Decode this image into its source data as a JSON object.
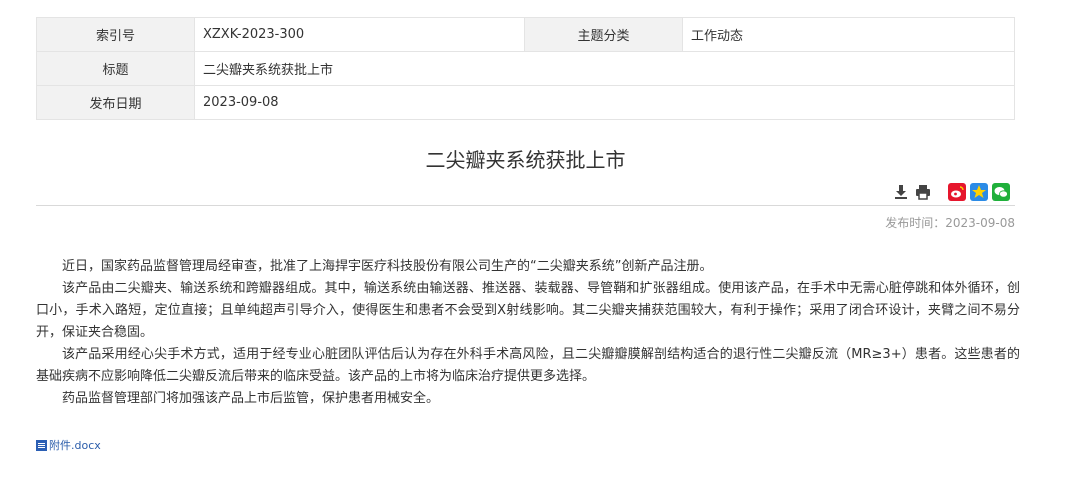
{
  "meta": {
    "index_label": "索引号",
    "index_value": "XZXK-2023-300",
    "category_label": "主题分类",
    "category_value": "工作动态",
    "title_label": "标题",
    "title_value": "二尖瓣夹系统获批上市",
    "date_label": "发布日期",
    "date_value": "2023-09-08"
  },
  "article": {
    "title": "二尖瓣夹系统获批上市",
    "pub_time_label": "发布时间：",
    "pub_time_value": "2023-09-08",
    "paragraphs": [
      "近日，国家药品监督管理局经审查，批准了上海捍宇医疗科技股份有限公司生产的“二尖瓣夹系统”创新产品注册。",
      "该产品由二尖瓣夹、输送系统和跨瓣器组成。其中，输送系统由输送器、推送器、装载器、导管鞘和扩张器组成。使用该产品，在手术中无需心脏停跳和体外循环，创口小，手术入路短，定位直接；且单纯超声引导介入，使得医生和患者不会受到X射线影响。其二尖瓣夹捕获范围较大，有利于操作；采用了闭合环设计，夹臂之间不易分开，保证夹合稳固。",
      "该产品采用经心尖手术方式，适用于经专业心脏团队评估后认为存在外科手术高风险，且二尖瓣瓣膜解剖结构适合的退行性二尖瓣反流（MR≥3+）患者。这些患者的基础疾病不应影响降低二尖瓣反流后带来的临床受益。该产品的上市将为临床治疗提供更多选择。",
      "药品监督管理部门将加强该产品上市后监管，保护患者用械安全。"
    ],
    "attachment": "附件.docx"
  },
  "colors": {
    "weibo": "#e6162d",
    "qzone": "#2b8be6",
    "wechat": "#20b03b"
  }
}
